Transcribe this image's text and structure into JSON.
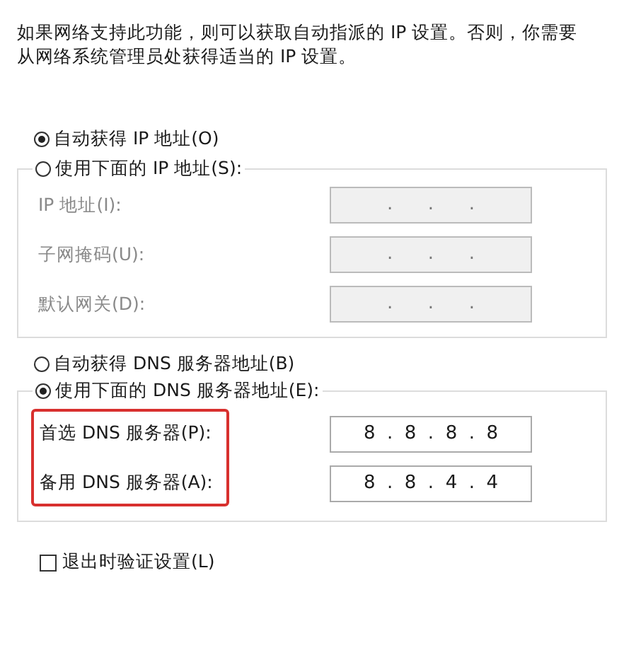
{
  "description": "如果网络支持此功能，则可以获取自动指派的 IP 设置。否则，你需要从网络系统管理员处获得适当的 IP 设置。",
  "ip_mode": [
    {
      "label": "自动获得 IP 地址(O)",
      "selected": true
    },
    {
      "label": "使用下面的 IP 地址(S):",
      "selected": false
    }
  ],
  "ip_fields": [
    {
      "label": "IP 地址(I):",
      "value": ".      .      .",
      "disabled": true
    },
    {
      "label": "子网掩码(U):",
      "value": ".      .      .",
      "disabled": true
    },
    {
      "label": "默认网关(D):",
      "value": ".      .      .",
      "disabled": true
    }
  ],
  "dns_mode": [
    {
      "label": "自动获得 DNS 服务器地址(B)",
      "selected": false
    },
    {
      "label": "使用下面的 DNS 服务器地址(E):",
      "selected": true
    }
  ],
  "dns_labels_highlighted": true,
  "dns_fields": [
    {
      "label": "首选 DNS 服务器(P):",
      "value": "8  .  8  .  8  .  8",
      "disabled": false
    },
    {
      "label": "备用 DNS 服务器(A):",
      "value": "8  .  8  .  4  .  4",
      "disabled": false
    }
  ],
  "validate_on_exit": {
    "label": "退出时验证设置(L)",
    "checked": false
  }
}
